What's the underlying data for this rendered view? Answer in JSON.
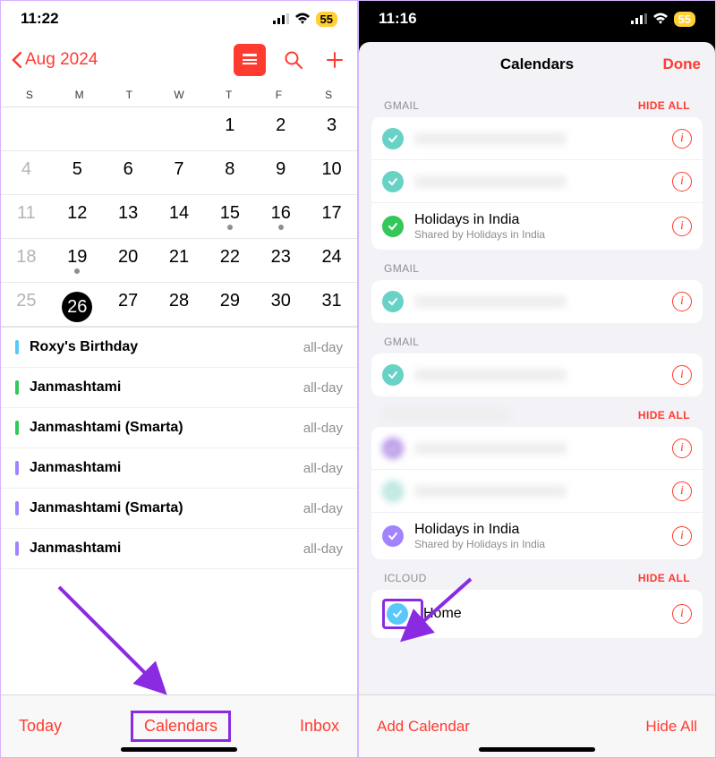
{
  "left": {
    "status": {
      "time": "11:22",
      "battery": "55"
    },
    "nav": {
      "month_label": "Aug 2024"
    },
    "days_of_week": [
      "S",
      "M",
      "T",
      "W",
      "T",
      "F",
      "S"
    ],
    "weeks": [
      [
        {
          "n": "",
          "dim": false
        },
        {
          "n": "",
          "dim": false
        },
        {
          "n": "",
          "dim": false
        },
        {
          "n": "",
          "dim": false
        },
        {
          "n": "1",
          "dim": false
        },
        {
          "n": "2",
          "dim": false
        },
        {
          "n": "3",
          "dim": false
        }
      ],
      [
        {
          "n": "4",
          "dim": true
        },
        {
          "n": "5",
          "dim": false
        },
        {
          "n": "6",
          "dim": false
        },
        {
          "n": "7",
          "dim": false
        },
        {
          "n": "8",
          "dim": false
        },
        {
          "n": "9",
          "dim": false
        },
        {
          "n": "10",
          "dim": false
        }
      ],
      [
        {
          "n": "11",
          "dim": true
        },
        {
          "n": "12",
          "dim": false
        },
        {
          "n": "13",
          "dim": false
        },
        {
          "n": "14",
          "dim": false
        },
        {
          "n": "15",
          "dim": false,
          "dot": true
        },
        {
          "n": "16",
          "dim": false,
          "dot": true
        },
        {
          "n": "17",
          "dim": false
        }
      ],
      [
        {
          "n": "18",
          "dim": true
        },
        {
          "n": "19",
          "dim": false,
          "dot": true
        },
        {
          "n": "20",
          "dim": false
        },
        {
          "n": "21",
          "dim": false
        },
        {
          "n": "22",
          "dim": false
        },
        {
          "n": "23",
          "dim": false
        },
        {
          "n": "24",
          "dim": false
        }
      ],
      [
        {
          "n": "25",
          "dim": true
        },
        {
          "n": "26",
          "dim": false,
          "today": true
        },
        {
          "n": "27",
          "dim": false
        },
        {
          "n": "28",
          "dim": false
        },
        {
          "n": "29",
          "dim": false
        },
        {
          "n": "30",
          "dim": false
        },
        {
          "n": "31",
          "dim": false
        }
      ]
    ],
    "events": [
      {
        "name": "Roxy's Birthday",
        "time": "all-day",
        "color": "#5ac8fa"
      },
      {
        "name": "Janmashtami",
        "time": "all-day",
        "color": "#34c759"
      },
      {
        "name": "Janmashtami (Smarta)",
        "time": "all-day",
        "color": "#34c759"
      },
      {
        "name": "Janmashtami",
        "time": "all-day",
        "color": "#a284ff"
      },
      {
        "name": "Janmashtami (Smarta)",
        "time": "all-day",
        "color": "#a284ff"
      },
      {
        "name": "Janmashtami",
        "time": "all-day",
        "color": "#a284ff"
      }
    ],
    "toolbar": {
      "today": "Today",
      "calendars": "Calendars",
      "inbox": "Inbox"
    }
  },
  "right": {
    "status": {
      "time": "11:16",
      "battery": "55"
    },
    "sheet_title": "Calendars",
    "done": "Done",
    "sections": [
      {
        "header": "GMAIL",
        "hide": "HIDE ALL",
        "rows": [
          {
            "blur": true,
            "color": "#69d2c6"
          },
          {
            "blur": true,
            "color": "#69d2c6"
          },
          {
            "name": "Holidays in India",
            "sub": "Shared by Holidays in India",
            "color": "#34c759"
          }
        ]
      },
      {
        "header": "GMAIL",
        "hide": "",
        "rows": [
          {
            "blur": true,
            "color": "#69d2c6"
          }
        ]
      },
      {
        "header": "GMAIL",
        "hide": "",
        "rows": [
          {
            "blur": true,
            "color": "#69d2c6"
          }
        ]
      },
      {
        "header": "(redacted)",
        "blurheader": true,
        "hide": "HIDE ALL",
        "rows": [
          {
            "blur": true,
            "color": "#b997e6",
            "blurchk": true
          },
          {
            "blur": true,
            "color": "#b8e6dd",
            "blurchk": true
          },
          {
            "name": "Holidays in India",
            "sub": "Shared by Holidays in India",
            "color": "#a284ff"
          }
        ]
      },
      {
        "header": "ICLOUD",
        "hide": "HIDE ALL",
        "rows": [
          {
            "name": "Home",
            "color": "#5ac8fa",
            "highlight": true
          }
        ]
      }
    ],
    "bottom": {
      "add": "Add Calendar",
      "hide": "Hide All"
    }
  }
}
